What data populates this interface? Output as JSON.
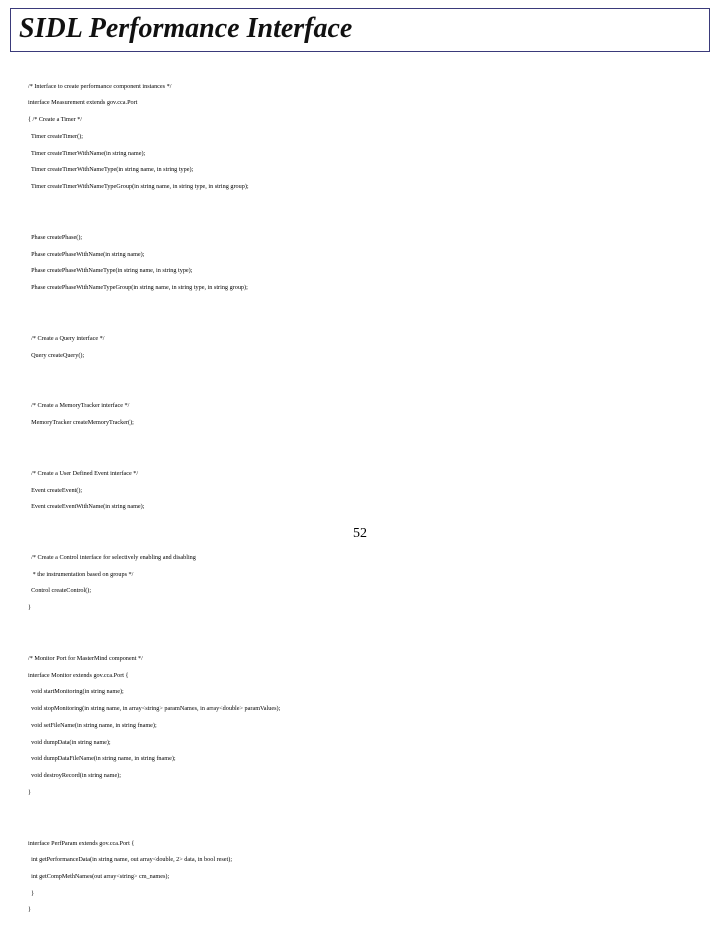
{
  "title": "SIDL Performance Interface",
  "pageNumber": "52",
  "code": {
    "b1": {
      "l1": "/* Interface to create performance component instances */",
      "l2": "interface Measurement extends gov.cca.Port",
      "l3": "{ /* Create a Timer */",
      "l4": "  Timer createTimer();",
      "l5": "  Timer createTimerWithName(in string name);",
      "l6": "  Timer createTimerWithNameType(in string name, in string type);",
      "l7": "  Timer createTimerWithNameTypeGroup(in string name, in string type, in string group);"
    },
    "b2": {
      "l1": "  Phase createPhase();",
      "l2": "  Phase createPhaseWithName(in string name);",
      "l3": "  Phase createPhaseWithNameType(in string name, in string type);",
      "l4": "  Phase createPhaseWithNameTypeGroup(in string name, in string type, in string group);"
    },
    "b3": {
      "l1": "  /* Create a Query interface */",
      "l2": "  Query createQuery();"
    },
    "b4": {
      "l1": "  /* Create a MemoryTracker interface */",
      "l2": "  MemoryTracker createMemoryTracker();"
    },
    "b5": {
      "l1": "  /* Create a User Defined Event interface */",
      "l2": "  Event createEvent();",
      "l3": "  Event createEventWithName(in string name);"
    },
    "b6": {
      "l1": "  /* Create a Control interface for selectively enabling and disabling",
      "l2": "   * the instrumentation based on groups */",
      "l3": "  Control createControl();",
      "l4": "}"
    },
    "b7": {
      "l1": "/* Monitor Port for MasterMind component */",
      "l2": "interface Monitor extends gov.cca.Port {",
      "l3": "  void startMonitoring(in string name);",
      "l4": "  void stopMonitoring(in string name, in array<string> paramNames, in array<double> paramValues);",
      "l5": "  void setFileName(in string name, in string fname);",
      "l6": "  void dumpData(in string name);",
      "l7": "  void dumpDataFileName(in string name, in string fname);",
      "l8": "  void destroyRecord(in string name);",
      "l9": "}"
    },
    "b8": {
      "l1": "interface PerfParam extends gov.cca.Port {",
      "l2": "  int getPerformanceData(in string name, out array<double, 2> data, in bool reset);",
      "l3": "  int getCompMethNames(out array<string> cm_names);",
      "l4": "  }",
      "l5": "}"
    }
  }
}
